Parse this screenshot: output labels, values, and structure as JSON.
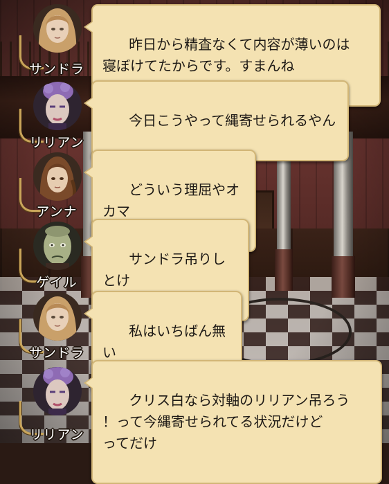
{
  "characters": {
    "sandra": {
      "name": "サンドラ",
      "hair": "#c9a06a",
      "skin": "#e8d0b8",
      "accent": "#8a6a40"
    },
    "lilian": {
      "name": "リリアン",
      "hair": "#8e6bb4",
      "skin": "#dcc8c0",
      "accent": "#5a3e7a"
    },
    "anna": {
      "name": "アンナ",
      "hair": "#7a4a2a",
      "skin": "#e6ccb0",
      "accent": "#4a2e1a"
    },
    "gale": {
      "name": "ゲイル",
      "hair": "#7a8a5a",
      "skin": "#a8b086",
      "accent": "#3c4630"
    }
  },
  "messages": [
    {
      "speaker": "サンドラ",
      "portrait_icon": "sandra-portrait-icon",
      "text": "昨日から精査なくて内容が薄いのは\n寝ぼけてたからです。すまんね"
    },
    {
      "speaker": "リリアン",
      "portrait_icon": "lilian-portrait-icon",
      "text": "今日こうやって縄寄せられるやん"
    },
    {
      "speaker": "アンナ",
      "portrait_icon": "anna-portrait-icon",
      "text": "どういう理屈やオカマ"
    },
    {
      "speaker": "ゲイル",
      "portrait_icon": "gale-portrait-icon",
      "text": "サンドラ吊りしとけ"
    },
    {
      "speaker": "サンドラ",
      "portrait_icon": "sandra-portrait-icon",
      "text": "私はいちばん無い"
    },
    {
      "speaker": "リリアン",
      "portrait_icon": "lilian-portrait-icon",
      "text": "クリス白なら対軸のリリアン吊ろう\n！って今縄寄せられてる状況だけど\nってだけ"
    }
  ],
  "colors": {
    "bubble_fill": "#f4e2b2",
    "bubble_border": "#d2b677",
    "name_text": "#ffffff",
    "frame_gold": "#c9a55a"
  }
}
